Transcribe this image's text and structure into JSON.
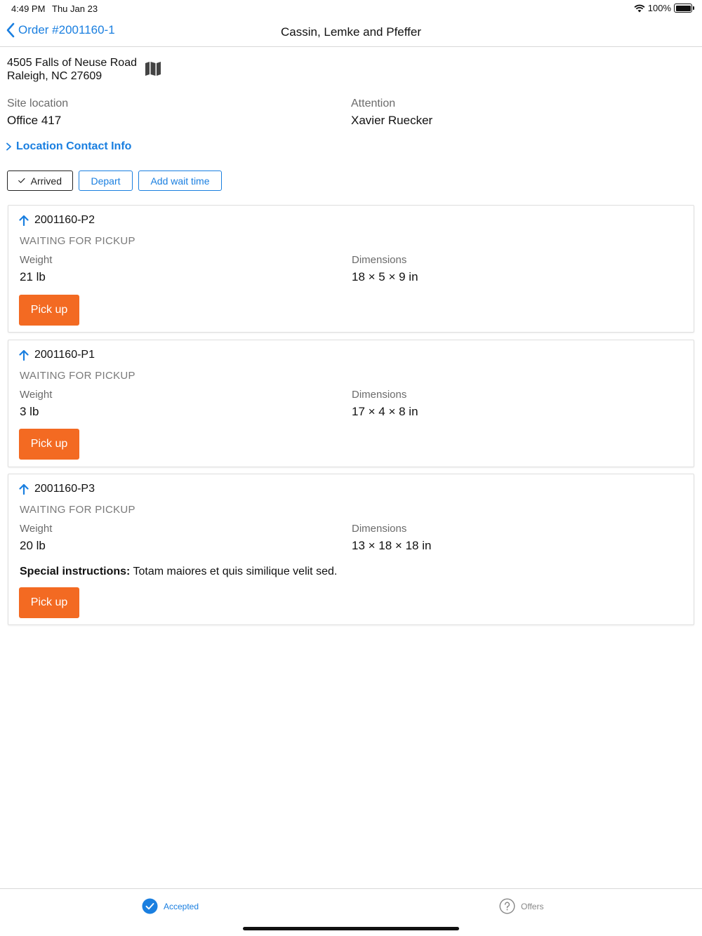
{
  "status_bar": {
    "time": "4:49 PM",
    "date": "Thu Jan 23",
    "battery": "100%"
  },
  "nav": {
    "back_label": "Order #2001160-1",
    "title": "Cassin, Lemke and Pfeffer"
  },
  "address": {
    "line1": "4505 Falls of Neuse Road",
    "line2": "Raleigh, NC 27609"
  },
  "site": {
    "label": "Site location",
    "value": "Office 417"
  },
  "attention": {
    "label": "Attention",
    "value": "Xavier Ruecker"
  },
  "contact_link": "Location Contact Info",
  "actions": {
    "arrived": "Arrived",
    "depart": "Depart",
    "wait": "Add wait time"
  },
  "packages": [
    {
      "id": "2001160-P2",
      "status": "WAITING FOR PICKUP",
      "weight_label": "Weight",
      "weight": "21 lb",
      "dims_label": "Dimensions",
      "dims": "18 × 5 × 9 in",
      "button": "Pick up"
    },
    {
      "id": "2001160-P1",
      "status": "WAITING FOR PICKUP",
      "weight_label": "Weight",
      "weight": "3 lb",
      "dims_label": "Dimensions",
      "dims": "17 × 4 × 8 in",
      "button": "Pick up"
    },
    {
      "id": "2001160-P3",
      "status": "WAITING FOR PICKUP",
      "weight_label": "Weight",
      "weight": "20 lb",
      "dims_label": "Dimensions",
      "dims": "13 × 18 × 18 in",
      "special_label": "Special instructions:",
      "special": "Totam maiores et quis similique velit sed.",
      "button": "Pick up"
    }
  ],
  "tabs": {
    "accepted": "Accepted",
    "offers": "Offers"
  },
  "colors": {
    "accent": "#1a7fe0",
    "pickup": "#f36a22"
  },
  "icons": [
    "back-chevron-icon",
    "map-icon",
    "chevron-right-icon",
    "checkmark-icon",
    "arrow-up-icon",
    "accepted-check-icon",
    "offers-question-icon",
    "wifi-icon",
    "battery-icon"
  ]
}
